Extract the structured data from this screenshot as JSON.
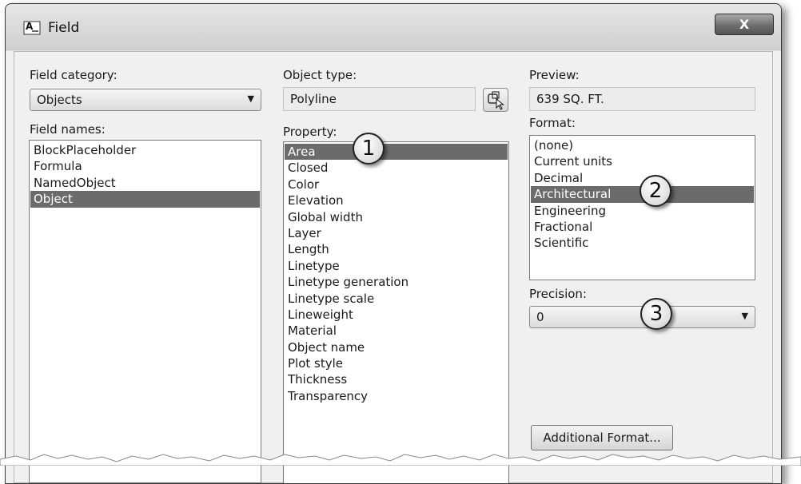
{
  "window": {
    "title": "Field",
    "close_label": "X"
  },
  "field_category": {
    "label": "Field category:",
    "selected": "Objects"
  },
  "field_names": {
    "label": "Field names:",
    "items": [
      "BlockPlaceholder",
      "Formula",
      "NamedObject",
      "Object"
    ],
    "selected_index": 3
  },
  "object_type": {
    "label": "Object type:",
    "value": "Polyline"
  },
  "property": {
    "label": "Property:",
    "items": [
      "Area",
      "Closed",
      "Color",
      "Elevation",
      "Global width",
      "Layer",
      "Length",
      "Linetype",
      "Linetype generation",
      "Linetype scale",
      "Lineweight",
      "Material",
      "Object name",
      "Plot style",
      "Thickness",
      "Transparency"
    ],
    "selected_index": 0
  },
  "preview": {
    "label": "Preview:",
    "value": "639 SQ. FT."
  },
  "format": {
    "label": "Format:",
    "items": [
      "(none)",
      "Current units",
      "Decimal",
      "Architectural",
      "Engineering",
      "Fractional",
      "Scientific"
    ],
    "selected_index": 3
  },
  "precision": {
    "label": "Precision:",
    "selected": "0"
  },
  "additional_format_button": "Additional Format...",
  "callouts": [
    "1",
    "2",
    "3"
  ],
  "icons": {
    "app": "field-app-icon",
    "select_object": "select-object-icon",
    "dropdown": "chevron-down-icon"
  }
}
